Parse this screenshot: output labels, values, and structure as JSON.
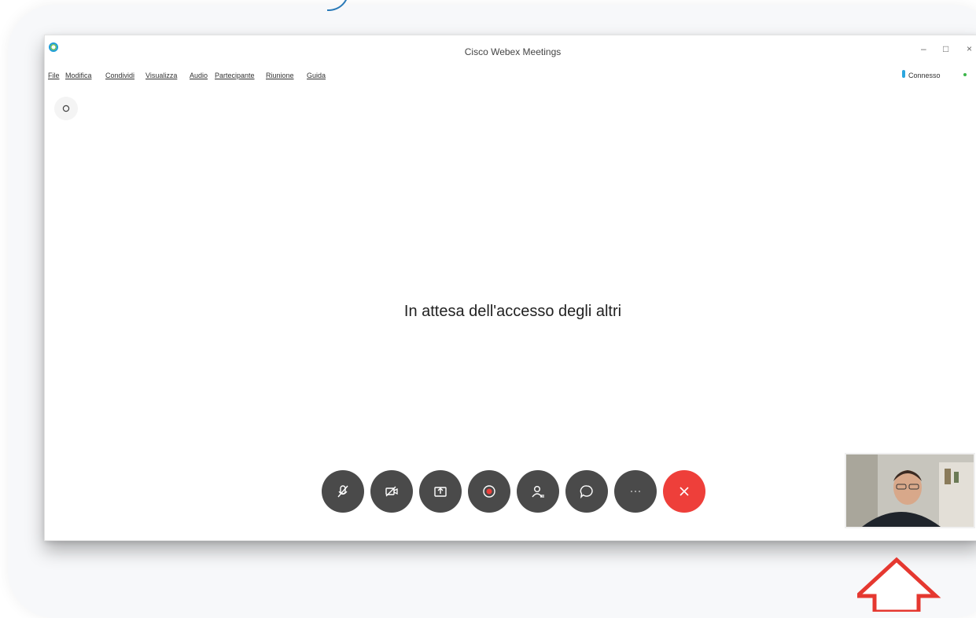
{
  "window": {
    "title": "Cisco Webex Meetings",
    "controls": {
      "minimize": "–",
      "maximize": "□",
      "close": "×"
    }
  },
  "menu": [
    {
      "label": "File"
    },
    {
      "label": "Modifica"
    },
    {
      "label": "Condividi"
    },
    {
      "label": "Visualizza"
    },
    {
      "label": "Audio"
    },
    {
      "label": "Partecipante"
    },
    {
      "label": "Riunione"
    },
    {
      "label": "Guida"
    }
  ],
  "status": {
    "text": "Connesso",
    "dot_color": "#3cb54a"
  },
  "main": {
    "waiting_text": "In attesa dell'accesso degli altri"
  },
  "controls": [
    {
      "name": "mute-icon",
      "interactable": true
    },
    {
      "name": "video-icon",
      "interactable": true
    },
    {
      "name": "share-icon",
      "interactable": true
    },
    {
      "name": "record-icon",
      "interactable": true
    },
    {
      "name": "participants-icon",
      "interactable": true
    },
    {
      "name": "chat-icon",
      "interactable": true
    },
    {
      "name": "more-icon",
      "interactable": true
    },
    {
      "name": "end-meeting-icon",
      "interactable": true
    }
  ],
  "colors": {
    "control_button": "#4a4a4a",
    "end_button": "#ee3f3a",
    "connected": "#3cb54a",
    "accent": "#2ba6de"
  }
}
